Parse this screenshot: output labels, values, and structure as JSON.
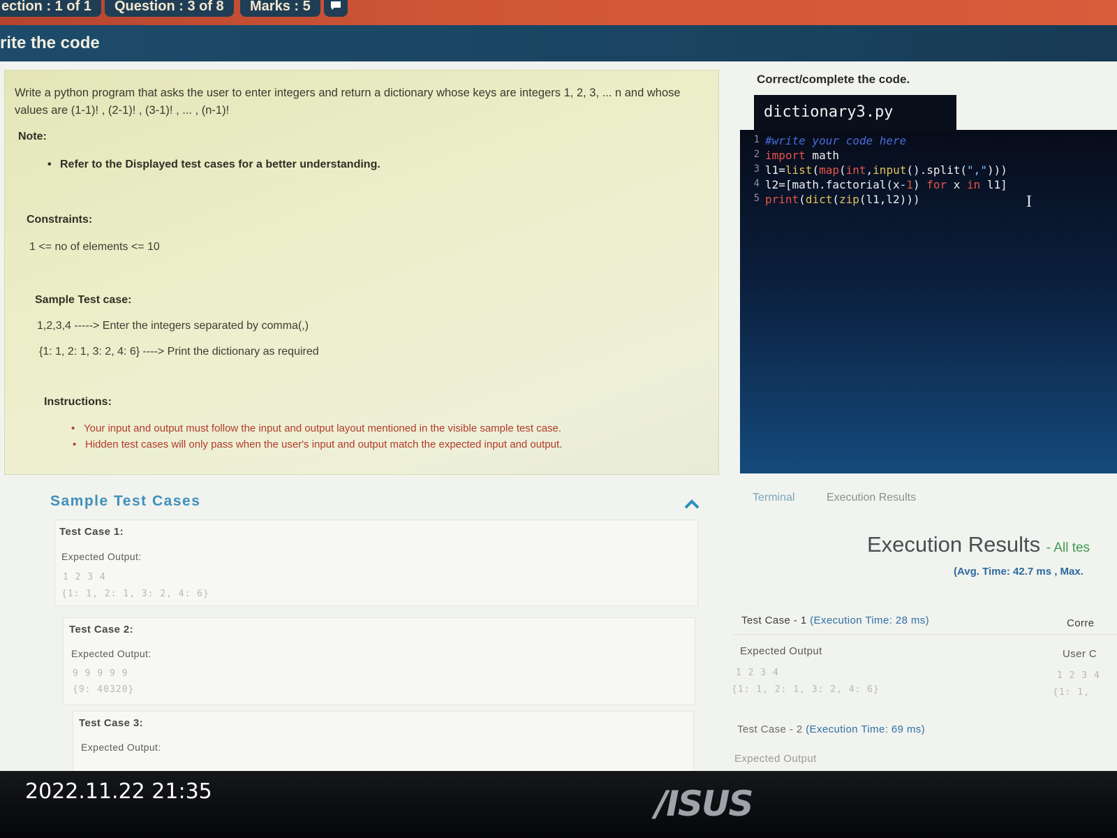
{
  "topbar": {
    "section": "ection : 1 of 1",
    "question": "Question : 3 of 8",
    "marks": "Marks : 5",
    "chat_icon": "chat-bubble-icon"
  },
  "section_title": "rite the code",
  "question": {
    "text": "Write a python program that asks the user to enter integers and return a dictionary whose keys are integers 1, 2, 3, ... n and whose values are (1-1)! , (2-1)! , (3-1)! , ... , (n-1)!",
    "note_label": "Note:",
    "note_item": "Refer to the Displayed test cases for a better understanding.",
    "constraints_label": "Constraints:",
    "constraints_text": "1 <= no of elements <= 10",
    "sample_label": "Sample Test case:",
    "sample_line1": "1,2,3,4 -----> Enter the integers separated by comma(,)",
    "sample_line2": "{1: 1, 2: 1, 3: 2, 4: 6} ----> Print the dictionary as required",
    "instructions_label": "Instructions:",
    "instructions": [
      "Your input and output must follow the input and output layout mentioned in the visible sample test case.",
      "Hidden test cases will only pass when the user's input and output match the expected input and output."
    ]
  },
  "editor": {
    "heading": "Correct/complete the code.",
    "filename": "dictionary3.py",
    "lines": [
      "1",
      "2",
      "3",
      "4",
      "5"
    ]
  },
  "sample_cases": {
    "title": "Sample Test Cases",
    "cases": [
      {
        "label": "Test Case 1:",
        "expected_label": "Expected Output:",
        "input": "1 2 3 4",
        "output": "{1: 1, 2: 1, 3: 2, 4: 6}"
      },
      {
        "label": "Test Case 2:",
        "expected_label": "Expected Output:",
        "input": "9 9 9 9 9",
        "output": "{9: 40320}"
      },
      {
        "label": "Test Case 3:",
        "expected_label": "Expected Output:"
      }
    ]
  },
  "results": {
    "tab_terminal": "Terminal",
    "tab_execution": "Execution Results",
    "title": "Execution Results",
    "title_suffix": "- All tes",
    "avg": "(Avg. Time: 42.7 ms , Max.",
    "case1": "Test Case - 1",
    "case1_time": "(Execution Time: 28 ms)",
    "case1_right": "Corre",
    "expected_label": "Expected Output",
    "user_label": "User C",
    "case1_input": "1 2 3 4",
    "case1_output": "{1: 1, 2: 1, 3: 2, 4: 6}",
    "user_input": "1 2 3 4",
    "user_output": "{1: 1,",
    "case2": "Test Case - 2",
    "case2_time": "(Execution Time: 69 ms)",
    "case2_expected": "Expected Output"
  },
  "overlay": {
    "timestamp": "2022.11.22 21:35",
    "brand": "/ISUS"
  }
}
